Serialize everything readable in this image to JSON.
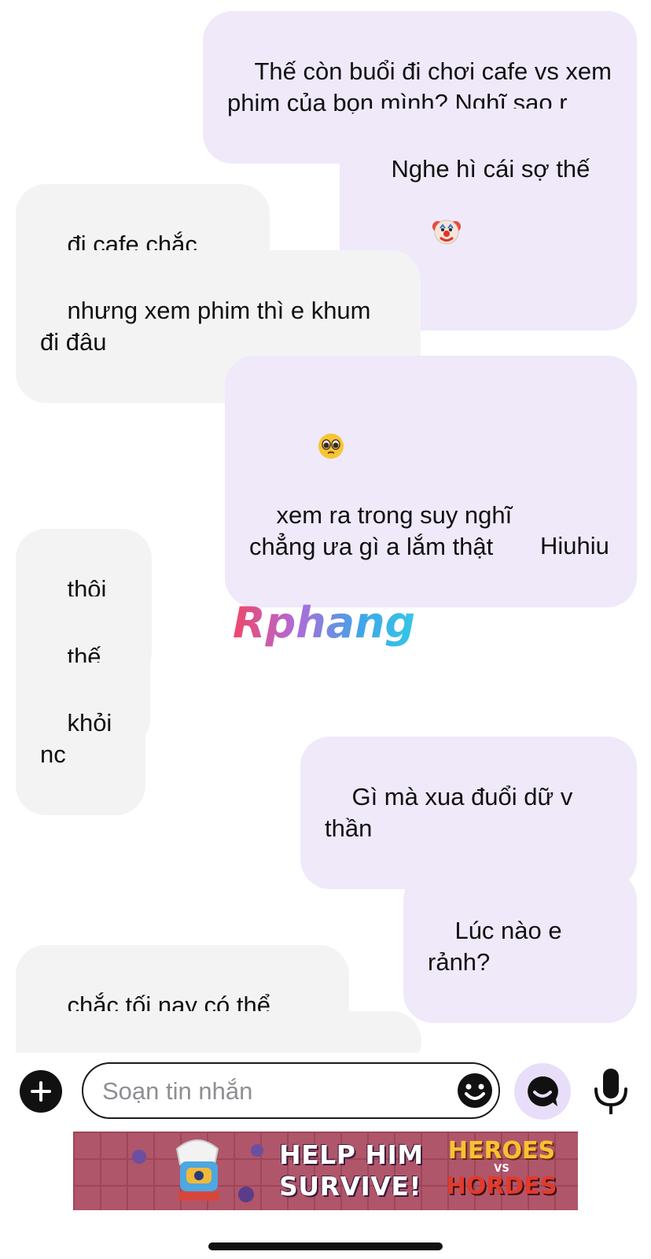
{
  "messages": [
    {
      "side": "out",
      "text": "Thế còn buổi đi chơi cafe vs xem\nphim của bọn mình? Nghĩ sao r"
    },
    {
      "side": "out",
      "text": "Nghe hì cái sợ thế",
      "emoji": "clown-emoji"
    },
    {
      "side": "in",
      "text": "đi cafe chắc được"
    },
    {
      "side": "in",
      "text": "nhưng xem phim thì e khum\nđi đâu"
    },
    {
      "side": "out",
      "text": "xem ra trong suy nghĩ của e\nchẳng ưa gì a lắm thật",
      "emoji": "pleading-face-emoji"
    },
    {
      "side": "out",
      "text": "Hiuhiu"
    },
    {
      "side": "in",
      "text": "thôi vậy"
    },
    {
      "side": "in",
      "text": "thế thôi"
    },
    {
      "side": "in",
      "text": "khỏi nc"
    },
    {
      "side": "out",
      "text": "Gì mà xua đuổi dữ v thần"
    },
    {
      "side": "out",
      "text": "",
      "emoji": "clown-emoji"
    },
    {
      "side": "out",
      "text": "Lúc nào e rảnh?"
    },
    {
      "side": "in",
      "text": "chắc tối nay có thể được"
    }
  ],
  "watermark": {
    "text": "Rphang"
  },
  "composer": {
    "placeholder": "Soạn tin nhắn",
    "icons": [
      "plus-icon",
      "smile-icon",
      "sticker-icon",
      "microphone-icon"
    ]
  },
  "ad": {
    "headline": "HELP HIM SURVIVE!",
    "logo_top": "HEROES",
    "logo_vs": "VS",
    "logo_bottom": "HORDES"
  },
  "colors": {
    "outgoing_bubble": "#efe9fa",
    "incoming_bubble": "#f3f3f4",
    "sticker_button_bg": "#e9def9"
  }
}
